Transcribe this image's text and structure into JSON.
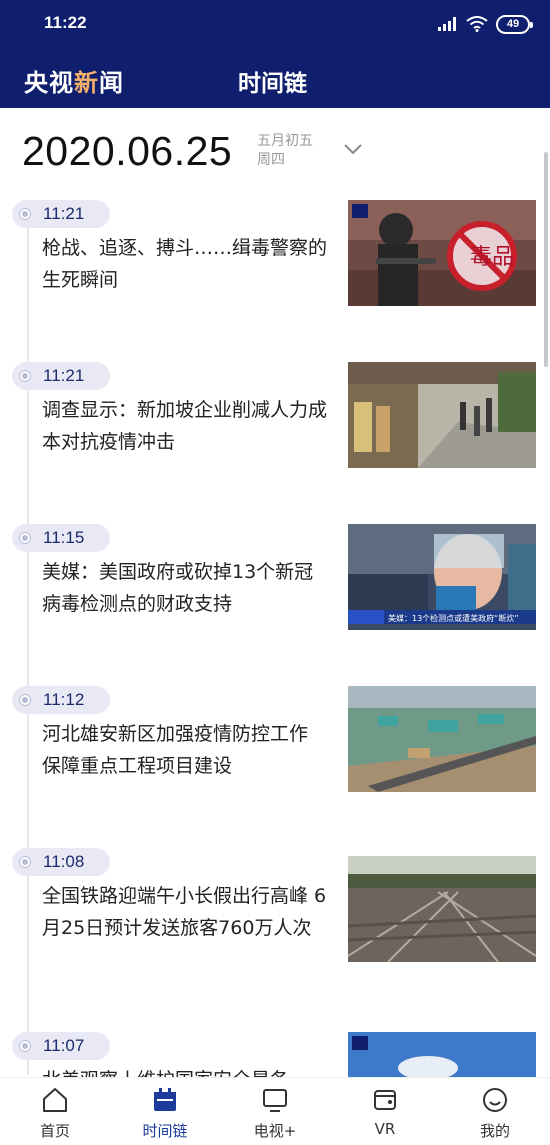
{
  "status": {
    "time": "11:22",
    "battery": "49"
  },
  "header": {
    "logo_part1": "央视",
    "logo_accent": "新",
    "logo_part2": "闻",
    "title": "时间链"
  },
  "date": {
    "main": "2020.06.25",
    "lunar_line1": "五月初五",
    "lunar_line2": "周四"
  },
  "items": [
    {
      "time": "11:21",
      "headline": "枪战、追逐、搏斗……缉毒警察的生死瞬间",
      "thumb": "drug-police-photo"
    },
    {
      "time": "11:21",
      "headline": "调查显示：新加坡企业削减人力成本对抗疫情冲击",
      "thumb": "singapore-street-photo"
    },
    {
      "time": "11:15",
      "headline": "美媒：美国政府或砍掉13个新冠病毒检测点的财政支持",
      "thumb": "covid-testing-photo",
      "thumb_caption": "美媒：13个检测点或遭美政府“断炊”"
    },
    {
      "time": "11:12",
      "headline": "河北雄安新区加强疫情防控工作 保障重点工程项目建设",
      "thumb": "xiongan-construction-photo"
    },
    {
      "time": "11:08",
      "headline": "全国铁路迎端午小长假出行高峰 6月25日预计发送旅客760万人次",
      "thumb": "railway-tracks-photo"
    },
    {
      "time": "11:07",
      "headline": "北美观察丨维护国家安全是各",
      "thumb": "rocket-launch-photo"
    }
  ],
  "nav": [
    {
      "label": "首页",
      "icon": "home-icon"
    },
    {
      "label": "时间链",
      "icon": "calendar-icon"
    },
    {
      "label": "电视+",
      "icon": "tv-icon"
    },
    {
      "label": "VR",
      "icon": "vr-icon"
    },
    {
      "label": "我的",
      "icon": "profile-icon"
    }
  ],
  "colors": {
    "header_bg": "#0f1f6e",
    "accent": "#f3b06b",
    "nav_active": "#1b3a9a"
  }
}
